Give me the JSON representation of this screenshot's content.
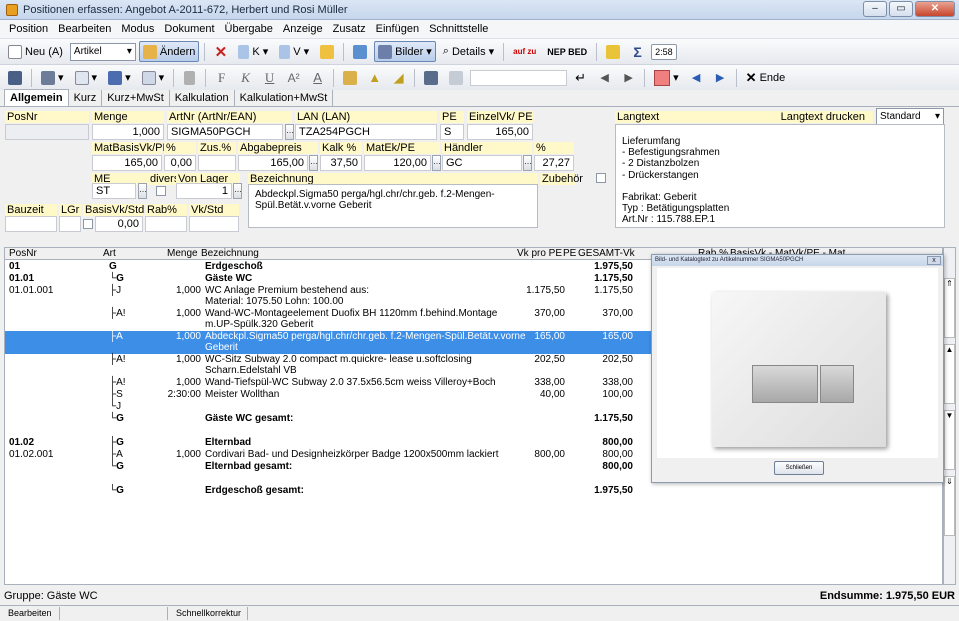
{
  "window": {
    "title": "Positionen erfassen: Angebot A-2011-672, Herbert und Rosi Müller",
    "btn_min": "–",
    "btn_max": "▭",
    "btn_close": "✕"
  },
  "menu": [
    "Position",
    "Bearbeiten",
    "Modus",
    "Dokument",
    "Übergabe",
    "Anzeige",
    "Zusatz",
    "Einfügen",
    "Schnittstelle"
  ],
  "toolbar1": {
    "neu_label": "Neu (A)",
    "artikel_combo": "Artikel",
    "aendern_label": "Ändern",
    "k_label": "K",
    "v_label": "V",
    "bilder_label": "Bilder",
    "details_label": "Details",
    "aufzu_label": "auf zu",
    "nep_bed_label": "NEP BED",
    "time_label": "2:58"
  },
  "toolbar2": {
    "font_f": "F",
    "font_k": "K",
    "font_u": "U",
    "ende_label": "Ende",
    "search_value": ""
  },
  "tabs": [
    "Allgemein",
    "Kurz",
    "Kurz+MwSt",
    "Kalkulation",
    "Kalkulation+MwSt"
  ],
  "form": {
    "labels": {
      "posnr": "PosNr",
      "menge": "Menge",
      "artnr": "ArtNr  (ArtNr/EAN)",
      "lan": "LAN   (LAN)",
      "pe": "PE",
      "einzelvk": "EinzelVk/ PE",
      "matbasis": "MatBasisVk/PE",
      "pct1": "%",
      "zus": "Zus.%",
      "abgabepreis": "Abgabepreis",
      "kalk": "Kalk %",
      "matek": "MatEk/PE",
      "haendler": "Händler",
      "pct2": "%",
      "me": "ME",
      "divers": "divers",
      "vonlager": "Von Lager",
      "bezeichnung": "Bezeichnung",
      "zubehoer": "Zubehör",
      "bauzeit": "Bauzeit",
      "lgr": "LGr",
      "basisvkstd": "BasisVk/Std",
      "rab": "Rab%",
      "vkstd": "Vk/Std",
      "langtext": "Langtext",
      "langtext_drucken": "Langtext drucken"
    },
    "values": {
      "posnr": "",
      "menge": "1,000",
      "artnr": "SIGMA50PGCH",
      "lan": "TZA254PGCH",
      "pe": "S",
      "einzelvk": "165,00",
      "matbasis": "165,00",
      "pct1": "0,00",
      "zus": "",
      "abgabepreis": "165,00",
      "kalk": "37,50",
      "matek": "120,00",
      "haendler": "GC",
      "pct2": "27,27",
      "me": "ST",
      "vonlager": "1",
      "bezeichnung": "Abdeckpl.Sigma50 perga/hgl.chr/chr.geb. f.2-Mengen-\nSpül.Betät.v.vorne Geberit",
      "basisvkstd": "0,00",
      "langtext_mode": "Standard",
      "langtext": "Lieferumfang\n- Befestigungsrahmen\n- 2 Distanzbolzen\n- Drückerstangen\n\nFabrikat: Geberit\nTyp      : Betätigungsplatten\nArt.Nr   : 115.788.EP.1"
    }
  },
  "grid": {
    "headers": [
      "PosNr",
      "Art",
      "Menge",
      "Bezeichnung",
      "Vk pro PE",
      "PE",
      "GESAMT-Vk",
      "Rab %",
      "BasisVk - Mat",
      "Vk/PE - Mat"
    ],
    "rows": [
      {
        "posnr": "01",
        "art": "G",
        "menge": "",
        "bez": "Erdgeschoß",
        "vk": "",
        "pe": "",
        "ges": "1.975,50",
        "bold": true,
        "sel": false
      },
      {
        "posnr": "01.01",
        "art": "└G",
        "menge": "",
        "bez": "Gäste WC",
        "vk": "",
        "pe": "",
        "ges": "1.175,50",
        "bold": true,
        "sel": false
      },
      {
        "posnr": "01.01.001",
        "art": "├J",
        "menge": "1,000",
        "bez": "WC Anlage Premium bestehend aus:",
        "bez2": "Material: 1075.50  Lohn: 100.00",
        "vk": "1.175,50",
        "pe": "",
        "ges": "1.175,50",
        "bold": false,
        "sel": false
      },
      {
        "posnr": "",
        "art": "├A!",
        "menge": "1,000",
        "bez": "Wand-WC-Montageelement Duofix BH 1120mm f.behind.Montage",
        "bez2": "m.UP-Spülk.320 Geberit",
        "vk": "370,00",
        "pe": "",
        "ges": "370,00",
        "bold": false,
        "sel": false
      },
      {
        "posnr": "",
        "art": "├A",
        "menge": "1,000",
        "bez": "Abdeckpl.Sigma50 perga/hgl.chr/chr.geb. f.2-Mengen-Spül.Betät.v.vorne",
        "bez2": "Geberit",
        "vk": "165,00",
        "pe": "",
        "ges": "165,00",
        "bold": false,
        "sel": true
      },
      {
        "posnr": "",
        "art": "├A!",
        "menge": "1,000",
        "bez": "WC-Sitz Subway 2.0 compact m.quickre- lease u.softclosing",
        "bez2": "Scharn.Edelstahl VB",
        "vk": "202,50",
        "pe": "",
        "ges": "202,50",
        "bold": false,
        "sel": false
      },
      {
        "posnr": "",
        "art": "├A!",
        "menge": "1,000",
        "bez": "Wand-Tiefspül-WC Subway 2.0 37.5x56.5cm weiss Villeroy+Boch",
        "vk": "338,00",
        "pe": "",
        "ges": "338,00",
        "bold": false,
        "sel": false
      },
      {
        "posnr": "",
        "art": "├S",
        "menge": "2:30:00",
        "bez": "Meister Wollthan",
        "vk": "40,00",
        "pe": "",
        "ges": "100,00",
        "bold": false,
        "sel": false
      },
      {
        "posnr": "",
        "art": "└J",
        "menge": "",
        "bez": "",
        "vk": "",
        "pe": "",
        "ges": "",
        "bold": false,
        "sel": false
      },
      {
        "posnr": "",
        "art": "└G",
        "menge": "",
        "bez": "Gäste WC gesamt:",
        "vk": "",
        "pe": "",
        "ges": "1.175,50",
        "bold": true,
        "sel": false
      },
      {
        "posnr": "",
        "art": "",
        "menge": "",
        "bez": "",
        "vk": "",
        "pe": "",
        "ges": "",
        "bold": false,
        "sel": false
      },
      {
        "posnr": "01.02",
        "art": "├G",
        "menge": "",
        "bez": "Elternbad",
        "vk": "",
        "pe": "",
        "ges": "800,00",
        "bold": true,
        "sel": false
      },
      {
        "posnr": "01.02.001",
        "art": "├A",
        "menge": "1,000",
        "bez": "Cordivari Bad- und Designheizkörper Badge 1200x500mm lackiert",
        "vk": "800,00",
        "pe": "",
        "ges": "800,00",
        "bold": false,
        "sel": false
      },
      {
        "posnr": "",
        "art": "└G",
        "menge": "",
        "bez": "Elternbad gesamt:",
        "vk": "",
        "pe": "",
        "ges": "800,00",
        "bold": true,
        "sel": false
      },
      {
        "posnr": "",
        "art": "",
        "menge": "",
        "bez": "",
        "vk": "",
        "pe": "",
        "ges": "",
        "bold": false,
        "sel": false
      },
      {
        "posnr": "",
        "art": "└G",
        "menge": "",
        "bez": "Erdgeschoß gesamt:",
        "vk": "",
        "pe": "",
        "ges": "1.975,50",
        "bold": true,
        "sel": false
      }
    ]
  },
  "popup": {
    "title": "Bild- und Katalogtext zu Artikelnummer SIGMA50PGCH",
    "close_btn": "x",
    "button": "Schließen"
  },
  "footer": {
    "gruppe": "Gruppe: Gäste WC",
    "endsumme": "Endsumme: 1.975,50 EUR"
  },
  "status": [
    "Bearbeiten",
    "",
    "Schnellkorrektur"
  ]
}
